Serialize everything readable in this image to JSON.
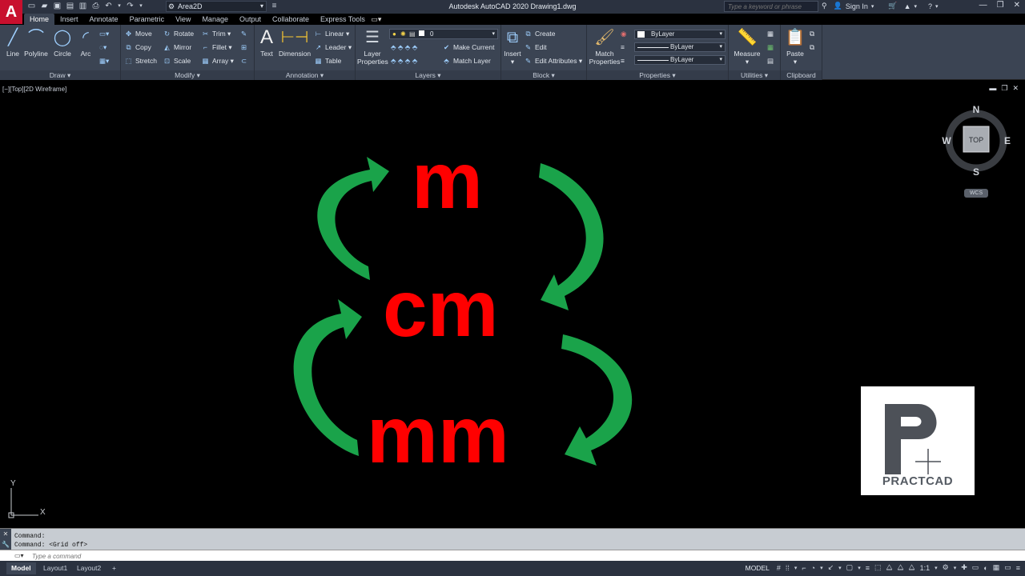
{
  "titlebar": {
    "logo": "A",
    "workspace": "Area2D",
    "title": "Autodesk AutoCAD 2020   Drawing1.dwg",
    "search_placeholder": "Type a keyword or phrase",
    "sign_in": "Sign In"
  },
  "ribbon_tabs": [
    "Home",
    "Insert",
    "Annotate",
    "Parametric",
    "View",
    "Manage",
    "Output",
    "Collaborate",
    "Express Tools"
  ],
  "ribbon": {
    "draw": {
      "title": "Draw",
      "line": "Line",
      "polyline": "Polyline",
      "circle": "Circle",
      "arc": "Arc"
    },
    "modify": {
      "title": "Modify",
      "move": "Move",
      "rotate": "Rotate",
      "trim": "Trim",
      "copy": "Copy",
      "mirror": "Mirror",
      "fillet": "Fillet",
      "stretch": "Stretch",
      "scale": "Scale",
      "array": "Array"
    },
    "annotation": {
      "title": "Annotation",
      "text": "Text",
      "dimension": "Dimension",
      "linear": "Linear",
      "leader": "Leader",
      "table": "Table"
    },
    "layers": {
      "title": "Layers",
      "layer_properties_1": "Layer",
      "layer_properties_2": "Properties",
      "current_layer": "0",
      "make_current": "Make Current",
      "match_layer": "Match Layer"
    },
    "block": {
      "title": "Block",
      "insert": "Insert",
      "create": "Create",
      "edit": "Edit",
      "edit_attributes": "Edit Attributes"
    },
    "properties": {
      "title": "Properties",
      "match_1": "Match",
      "match_2": "Properties",
      "color": "ByLayer",
      "lineweight": "ByLayer",
      "linetype": "ByLayer"
    },
    "utilities": {
      "title": "Utilities",
      "measure": "Measure"
    },
    "clipboard": {
      "title": "Clipboard",
      "paste": "Paste"
    }
  },
  "viewport": {
    "label": "[−][Top][2D Wireframe]",
    "viewcube": {
      "top": "TOP",
      "north": "N",
      "south": "S",
      "east": "E",
      "west": "W"
    },
    "wcs": "WCS",
    "units": {
      "top": "m",
      "middle": "cm",
      "bottom": "mm"
    },
    "logo_text": "PRACTCAD",
    "ucs_x": "X",
    "ucs_y": "Y",
    "colors": {
      "text": "#ff0000",
      "arrow": "#1aa34a"
    }
  },
  "command": {
    "history": [
      "Command:",
      "Command:  <Grid off>"
    ],
    "placeholder": "Type a command"
  },
  "status": {
    "layouts": [
      "Model",
      "Layout1",
      "Layout2"
    ],
    "model_label": "MODEL",
    "scale": "1:1"
  }
}
